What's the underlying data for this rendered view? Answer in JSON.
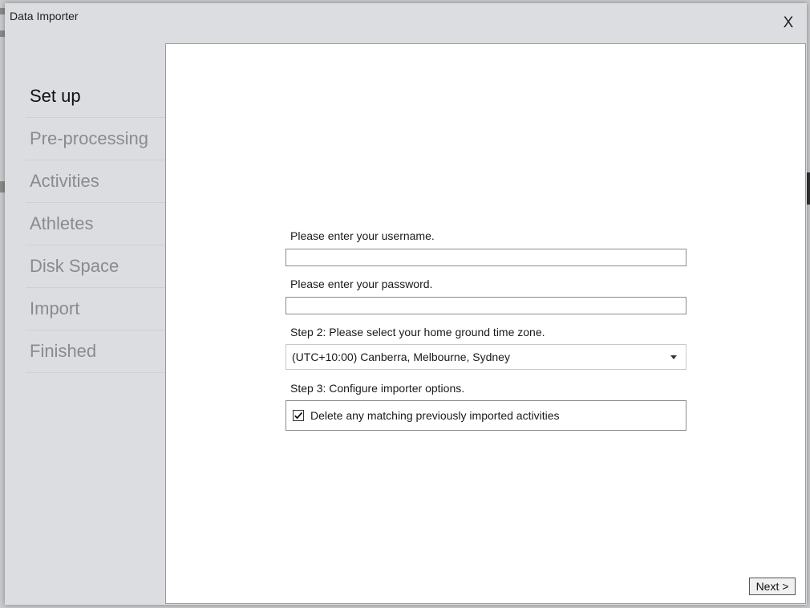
{
  "window": {
    "title": "Data Importer",
    "close_label": "X"
  },
  "sidebar": {
    "steps": [
      {
        "label": "Set up",
        "active": true
      },
      {
        "label": "Pre-processing",
        "active": false
      },
      {
        "label": "Activities",
        "active": false
      },
      {
        "label": "Athletes",
        "active": false
      },
      {
        "label": "Disk Space",
        "active": false
      },
      {
        "label": "Import",
        "active": false
      },
      {
        "label": "Finished",
        "active": false
      }
    ]
  },
  "form": {
    "username_label": "Please enter your username.",
    "username_value": "",
    "password_label": "Please enter your password.",
    "password_value": "",
    "timezone_label": "Step 2: Please select your home ground time zone.",
    "timezone_value": "(UTC+10:00) Canberra, Melbourne, Sydney",
    "options_label": "Step 3: Configure importer options.",
    "delete_option_label": "Delete any matching previously imported activities",
    "delete_option_checked": true
  },
  "footer": {
    "next_label": "Next >"
  },
  "icons": {
    "close": "close-icon",
    "dropdown": "chevron-down-icon",
    "check": "checkmark-icon"
  }
}
